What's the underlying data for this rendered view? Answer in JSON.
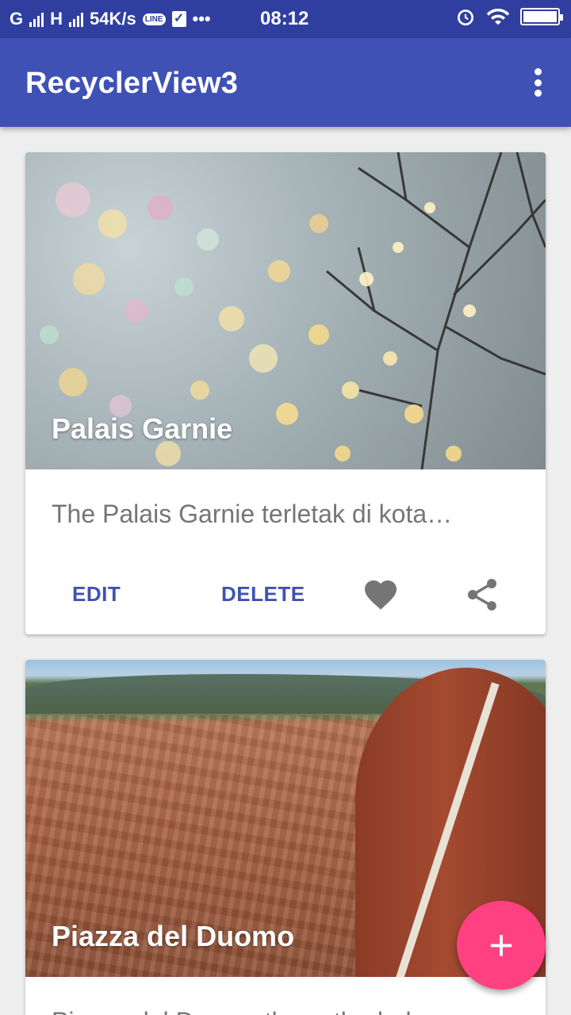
{
  "status_bar": {
    "carrier1": "G",
    "carrier2": "H",
    "speed": "54K/s",
    "line_badge": "LINE",
    "more": "•••",
    "time": "08:12"
  },
  "app_bar": {
    "title": "RecyclerView3"
  },
  "cards": [
    {
      "title": "Palais Garnie",
      "description": "The Palais Garnie terletak di kota…",
      "edit_label": "EDIT",
      "delete_label": "DELETE"
    },
    {
      "title": "Piazza del Duomo",
      "description": "Piazza del Duomo the cathedral"
    }
  ],
  "fab": {
    "icon": "add-icon",
    "label": "+"
  },
  "colors": {
    "status_bar": "#303f9f",
    "primary": "#3f51b5",
    "accent": "#ff4081",
    "icon_gray": "#757575"
  }
}
